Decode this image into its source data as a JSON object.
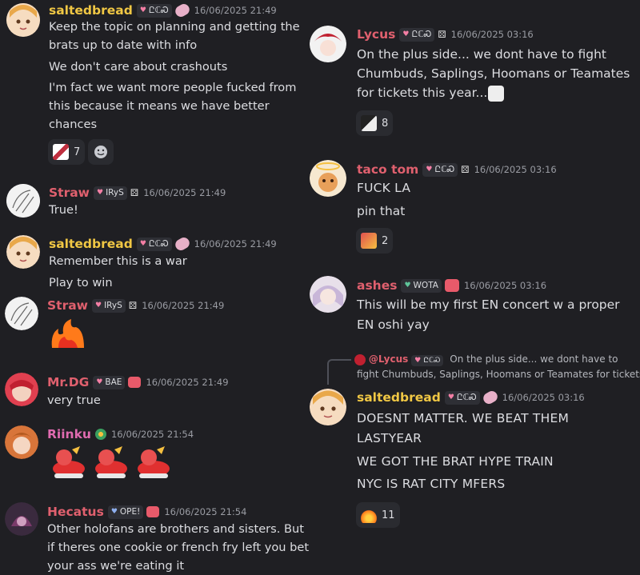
{
  "left": [
    {
      "user": "saltedbread",
      "color": "#f0c744",
      "tag": "ԸℂᏍ",
      "timestamp": "16/06/2025 21:49",
      "lines": [
        "Keep the topic on planning and getting the",
        "brats up to date with info",
        "We don't care about crashouts",
        "I'm fact we want more people fucked from",
        "this because it means we have better",
        "chances"
      ],
      "reaction_count": "7"
    },
    {
      "user": "Straw",
      "color": "#e0606e",
      "tag": "IRyS",
      "timestamp": "16/06/2025 21:49",
      "lines": [
        "True!"
      ]
    },
    {
      "user": "saltedbread",
      "color": "#f0c744",
      "tag": "ԸℂᏍ",
      "timestamp": "16/06/2025 21:49",
      "lines": [
        "Remember this is a war",
        "Play to win"
      ]
    },
    {
      "user": "Straw",
      "color": "#e0606e",
      "tag": "IRyS",
      "timestamp": "16/06/2025 21:49",
      "lines": []
    },
    {
      "user": "Mr.DG",
      "color": "#e0606e",
      "tag": "BAE",
      "timestamp": "16/06/2025 21:49",
      "lines": [
        "very true"
      ]
    },
    {
      "user": "Riinku",
      "color": "#e06bb0",
      "tag": "",
      "timestamp": "16/06/2025 21:54",
      "lines": []
    },
    {
      "user": "Hecatus",
      "color": "#e0606e",
      "tag": "OPE!",
      "timestamp": "16/06/2025 21:54",
      "lines": [
        "Other holofans are brothers and sisters. But",
        "if theres one cookie or french fry left you bet",
        "your ass we're eating it"
      ]
    }
  ],
  "right": [
    {
      "user": "Lycus",
      "color": "#e0606e",
      "tag": "ԸℂᏍ",
      "timestamp": "16/06/2025 03:16",
      "lines": [
        "On the plus side... we dont have to fight",
        "Chumbuds, Saplings, Hoomans or Teamates",
        "for tickets this year..."
      ],
      "reaction_count": "8"
    },
    {
      "user": "taco tom",
      "color": "#e0606e",
      "tag": "ԸℂᏍ",
      "timestamp": "16/06/2025 03:16",
      "lines": [
        "FUCK LA",
        "pin that"
      ],
      "reaction_count": "2"
    },
    {
      "user": "ashes",
      "color": "#e0606e",
      "tag": "WOTA",
      "timestamp": "16/06/2025 03:16",
      "lines": [
        "This will be my first EN concert w a proper",
        "EN oshi yay"
      ]
    },
    {
      "user": "saltedbread",
      "color": "#f0c744",
      "tag": "ԸℂᏍ",
      "timestamp": "16/06/2025 03:16",
      "reply": {
        "name": "@Lycus",
        "tag": "ԸℂᏍ",
        "text1": "On the plus side... we dont have to",
        "text2": "fight Chumbuds, Saplings, Hoomans or Teamates for tickets"
      },
      "lines": [
        "DOESNT MATTER. WE BEAT THEM",
        "LASTYEAR",
        "WE GOT THE BRAT HYPE TRAIN",
        "NYC IS RAT CITY MFERS"
      ],
      "reaction_count": "11"
    }
  ],
  "icons": {
    "heart": "♥",
    "dice": "🎲"
  },
  "colors": {
    "bg": "#1f1f23",
    "tagbg": "#2e2f35",
    "pinkheart": "#f47fa5",
    "greenheart": "#5fc59a",
    "blueheart": "#8fb0f0"
  }
}
